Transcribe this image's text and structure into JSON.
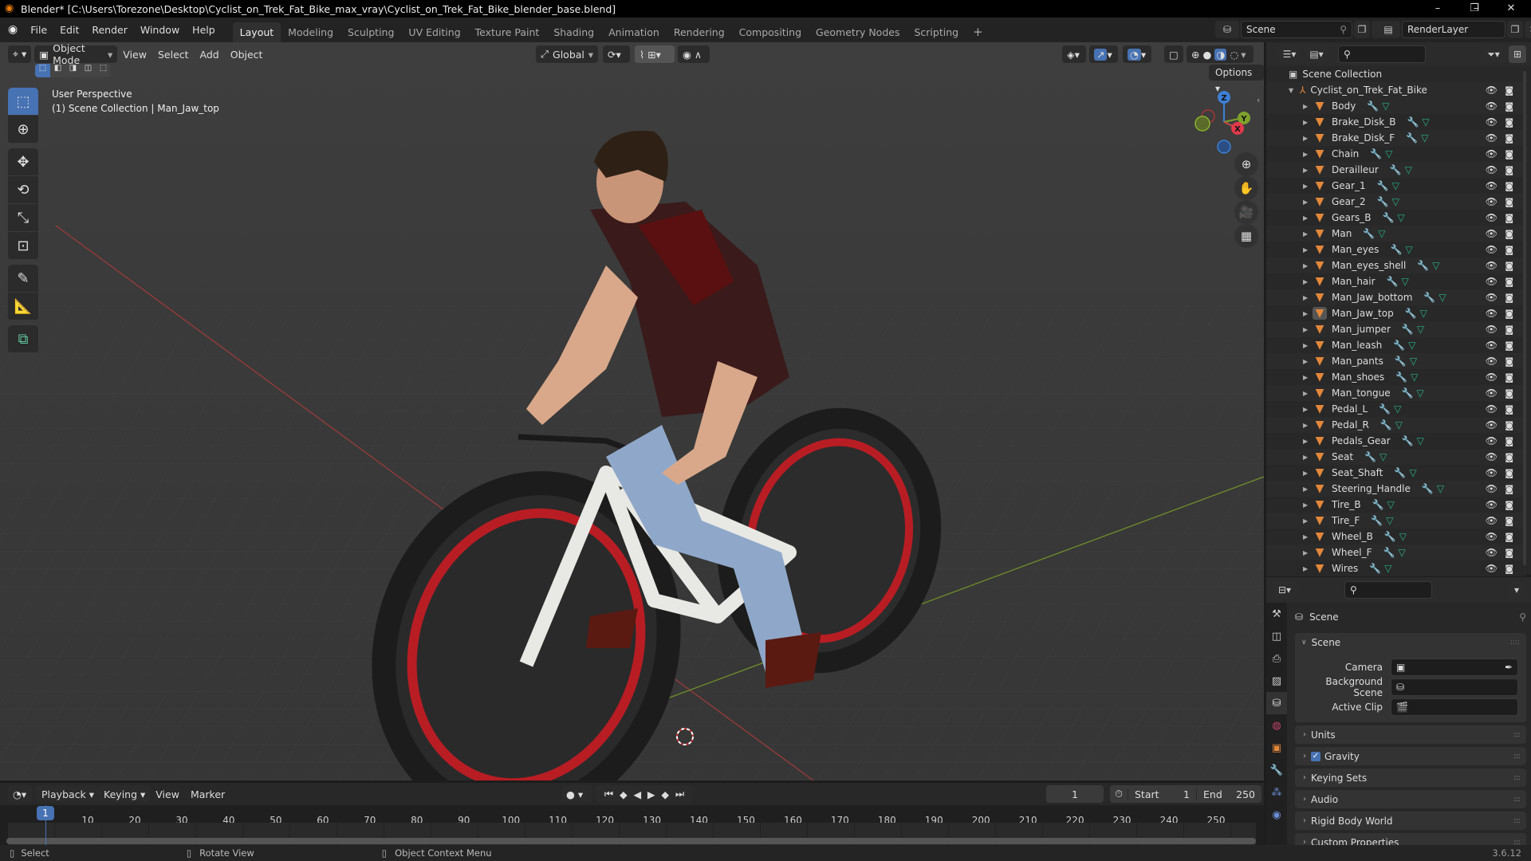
{
  "window": {
    "title": "Blender* [C:\\Users\\Torezone\\Desktop\\Cyclist_on_Trek_Fat_Bike_max_vray\\Cyclist_on_Trek_Fat_Bike_blender_base.blend]",
    "minimize": "–",
    "maximize": "❐",
    "close": "✕"
  },
  "menubar": [
    "File",
    "Edit",
    "Render",
    "Window",
    "Help"
  ],
  "workspaces": [
    "Layout",
    "Modeling",
    "Sculpting",
    "UV Editing",
    "Texture Paint",
    "Shading",
    "Animation",
    "Rendering",
    "Compositing",
    "Geometry Nodes",
    "Scripting"
  ],
  "active_workspace": "Layout",
  "scene_selector": {
    "value": "Scene"
  },
  "view_layer_selector": {
    "value": "RenderLayer"
  },
  "viewport": {
    "mode": "Object Mode",
    "menus": [
      "View",
      "Select",
      "Add",
      "Object"
    ],
    "transform_orientation": "Global",
    "options_label": "Options",
    "info_line1": "User Perspective",
    "info_line2": "(1) Scene Collection | Man_Jaw_top",
    "gizmo": {
      "z": "Z",
      "y": "Y",
      "x": "X"
    },
    "colors": {
      "x_axis": "#c84a4a",
      "y_axis": "#7fa12c",
      "z_axis": "#3d7fd6",
      "accent": "#4772b3"
    }
  },
  "outliner": {
    "root": "Scene Collection",
    "collection": "Cyclist_on_Trek_Fat_Bike",
    "active_object": "Man_Jaw_top",
    "objects": [
      "Body",
      "Brake_Disk_B",
      "Brake_Disk_F",
      "Chain",
      "Derailleur",
      "Gear_1",
      "Gear_2",
      "Gears_B",
      "Man",
      "Man_eyes",
      "Man_eyes_shell",
      "Man_hair",
      "Man_Jaw_bottom",
      "Man_Jaw_top",
      "Man_jumper",
      "Man_leash",
      "Man_pants",
      "Man_shoes",
      "Man_tongue",
      "Pedal_L",
      "Pedal_R",
      "Pedals_Gear",
      "Seat",
      "Seat_Shaft",
      "Steering_Handle",
      "Tire_B",
      "Tire_F",
      "Wheel_B",
      "Wheel_F",
      "Wires"
    ]
  },
  "properties": {
    "context_title": "Scene",
    "scene_panel": {
      "title": "Scene",
      "camera_label": "Camera",
      "camera_value": "",
      "background_scene_label": "Background Scene",
      "background_scene_value": "",
      "active_clip_label": "Active Clip",
      "active_clip_value": ""
    },
    "panels": [
      {
        "title": "Units"
      },
      {
        "title": "Gravity",
        "checkbox": true
      },
      {
        "title": "Keying Sets"
      },
      {
        "title": "Audio"
      },
      {
        "title": "Rigid Body World"
      },
      {
        "title": "Custom Properties"
      }
    ]
  },
  "timeline": {
    "menus": [
      "Playback",
      "Keying",
      "View",
      "Marker"
    ],
    "current_frame": "1",
    "start_label": "Start",
    "start": "1",
    "end_label": "End",
    "end": "250",
    "ticks": [
      "1",
      "10",
      "20",
      "30",
      "40",
      "50",
      "60",
      "70",
      "80",
      "90",
      "100",
      "110",
      "120",
      "130",
      "140",
      "150",
      "160",
      "170",
      "180",
      "190",
      "200",
      "210",
      "220",
      "230",
      "240",
      "250"
    ]
  },
  "statusbar": {
    "select": "Select",
    "rotate": "Rotate View",
    "context": "Object Context Menu",
    "version": "3.6.12"
  }
}
